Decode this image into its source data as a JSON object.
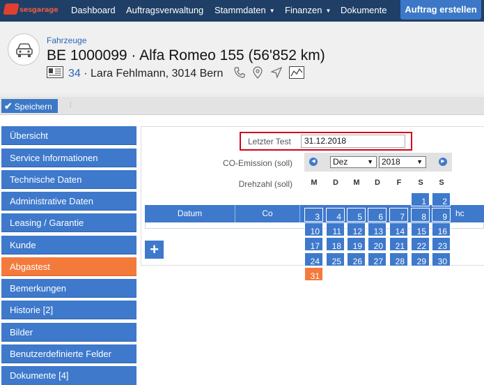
{
  "brand": {
    "name": "sesgarage"
  },
  "topnav": {
    "items": [
      {
        "label": "Dashboard",
        "caret": false
      },
      {
        "label": "Auftragsverwaltung",
        "caret": false
      },
      {
        "label": "Stammdaten",
        "caret": true
      },
      {
        "label": "Finanzen",
        "caret": true
      },
      {
        "label": "Dokumente",
        "caret": false
      }
    ],
    "cta_label": "Auftrag erstellen"
  },
  "header": {
    "breadcrumb": "Fahrzeuge",
    "title": "BE 1000099 · Alfa Romeo 155 (56'852 km)",
    "customer_id": "34",
    "customer_sep": " · ",
    "customer_name": "Lara Fehlmann, 3014 Bern",
    "icons": [
      "id-card-icon",
      "phone-icon",
      "map-pin-icon",
      "send-icon",
      "chart-icon"
    ]
  },
  "toolbar": {
    "save_label": "Speichern"
  },
  "sidebar": {
    "items": [
      {
        "label": "Übersicht",
        "active": false
      },
      {
        "label": "Service Informationen",
        "active": false
      },
      {
        "label": "Technische Daten",
        "active": false
      },
      {
        "label": "Administrative Daten",
        "active": false
      },
      {
        "label": "Leasing / Garantie",
        "active": false
      },
      {
        "label": "Kunde",
        "active": false
      },
      {
        "label": "Abgastest",
        "active": true
      },
      {
        "label": "Bemerkungen",
        "active": false
      },
      {
        "label": "Historie [2]",
        "active": false
      },
      {
        "label": "Bilder",
        "active": false
      },
      {
        "label": "Benutzerdefinierte Felder",
        "active": false
      },
      {
        "label": "Dokumente [4]",
        "active": false
      }
    ]
  },
  "form": {
    "last_test_label": "Letzter Test",
    "last_test_value": "31.12.2018",
    "co_label": "CO-Emission (soll)",
    "rpm_label": "Drehzahl (soll)"
  },
  "table": {
    "columns": [
      "Datum",
      "Co",
      "hc"
    ]
  },
  "add_button": "+",
  "datepicker": {
    "month": "Dez",
    "year": "2018",
    "weekdays": [
      "M",
      "D",
      "M",
      "D",
      "F",
      "S",
      "S"
    ],
    "days": [
      "1",
      "2",
      "3",
      "4",
      "5",
      "6",
      "7",
      "8",
      "9",
      "10",
      "11",
      "12",
      "13",
      "14",
      "15",
      "16",
      "17",
      "18",
      "19",
      "20",
      "21",
      "22",
      "23",
      "24",
      "25",
      "26",
      "27",
      "28",
      "29",
      "30",
      "31"
    ],
    "first_weekday_index": 5,
    "selected_day": "31"
  }
}
